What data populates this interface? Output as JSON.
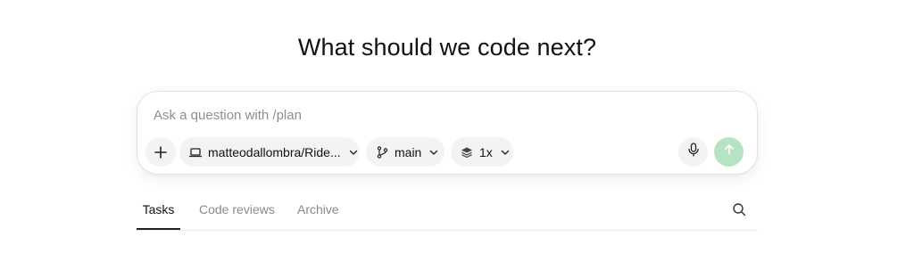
{
  "headline": "What should we code next?",
  "composer": {
    "placeholder": "Ask a question with /plan",
    "value": "",
    "repo_label": "matteodallombra/Ride...",
    "branch_label": "main",
    "count_label": "1x",
    "icons": {
      "add": "plus-icon",
      "repo": "laptop-icon",
      "branch": "git-branch-icon",
      "count": "layers-icon",
      "chevron": "chevron-down-icon",
      "mic": "microphone-icon",
      "send": "arrow-up-icon"
    },
    "send_color": "#b6e3c4"
  },
  "tabs": [
    {
      "label": "Tasks",
      "active": true
    },
    {
      "label": "Code reviews",
      "active": false
    },
    {
      "label": "Archive",
      "active": false
    }
  ],
  "search_icon": "search-icon"
}
